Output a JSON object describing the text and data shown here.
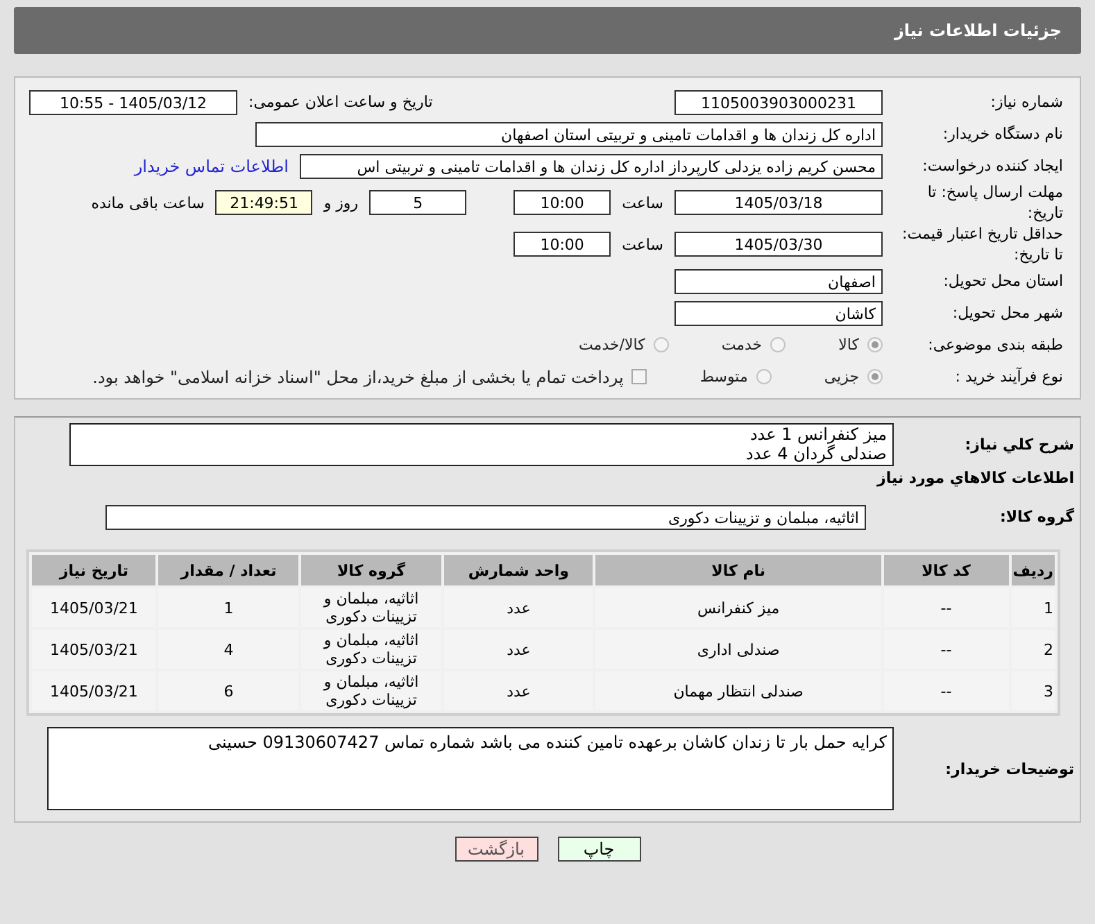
{
  "title": "جزئیات اطلاعات نیاز",
  "need_number": {
    "label": "شماره نیاز:",
    "value": "1105003903000231"
  },
  "announce": {
    "label": "تاریخ و ساعت اعلان عمومی:",
    "value": "1405/03/12 - 10:55"
  },
  "buyer_org": {
    "label": "نام دستگاه خریدار:",
    "value": "اداره کل زندان ها و اقدامات تامینی و تربیتی استان اصفهان"
  },
  "requester": {
    "label": "ایجاد کننده درخواست:",
    "value": "محسن کریم زاده یزدلی کارپرداز اداره کل زندان ها و اقدامات تامینی و تربیتی اس",
    "link": "اطلاعات تماس خریدار"
  },
  "reply_deadline": {
    "label": "مهلت ارسال پاسخ: تا تاریخ:",
    "date": "1405/03/18",
    "time_label": "ساعت",
    "time": "10:00",
    "days": "5",
    "days_label": "روز و",
    "remaining": "21:49:51",
    "remaining_label": "ساعت باقی مانده"
  },
  "validity": {
    "label": "حداقل تاریخ اعتبار قیمت: تا تاریخ:",
    "date": "1405/03/30",
    "time_label": "ساعت",
    "time": "10:00"
  },
  "province": {
    "label": "استان محل تحویل:",
    "value": "اصفهان"
  },
  "city": {
    "label": "شهر محل تحویل:",
    "value": "کاشان"
  },
  "category": {
    "label": "طبقه بندی موضوعی:",
    "options": [
      {
        "label": "کالا",
        "selected": true
      },
      {
        "label": "خدمت",
        "selected": false
      },
      {
        "label": "کالا/خدمت",
        "selected": false
      }
    ]
  },
  "purchase_type": {
    "label": "نوع فرآیند خرید :",
    "options": [
      {
        "label": "جزیی",
        "selected": true
      },
      {
        "label": "متوسط",
        "selected": false
      }
    ],
    "checkbox": {
      "label": "پرداخت تمام یا بخشی از مبلغ خرید،از محل \"اسناد خزانه اسلامی\" خواهد بود.",
      "checked": false
    }
  },
  "description": {
    "label": "شرح کلي نياز:",
    "lines": [
      "میز کنفرانس 1 عدد",
      "صندلی گردان 4 عدد"
    ]
  },
  "goods_title": "اطلاعات کالاهاي مورد نياز",
  "goods_group": {
    "label": "گروه کالا:",
    "value": "اثاثیه، مبلمان و تزیینات دکوری"
  },
  "table": {
    "columns": [
      "ردیف",
      "کد کالا",
      "نام کالا",
      "واحد شمارش",
      "گروه کالا",
      "تعداد / مقدار",
      "تاریخ نیاز"
    ],
    "rows": [
      [
        "1",
        "--",
        "میز کنفرانس",
        "عدد",
        "اثاثیه، مبلمان و تزیینات دکوری",
        "1",
        "1405/03/21"
      ],
      [
        "2",
        "--",
        "صندلی اداری",
        "عدد",
        "اثاثیه، مبلمان و تزیینات دکوری",
        "4",
        "1405/03/21"
      ],
      [
        "3",
        "--",
        "صندلی انتظار مهمان",
        "عدد",
        "اثاثیه، مبلمان و تزیینات دکوری",
        "6",
        "1405/03/21"
      ]
    ]
  },
  "buyer_notes": {
    "label": "توضیحات خریدار:",
    "value": "کرایه حمل بار تا زندان کاشان برعهده تامین کننده می باشد شماره تماس 09130607427 حسینی"
  },
  "buttons": [
    {
      "label": "چاپ",
      "kind": "print"
    },
    {
      "label": "بازگشت",
      "kind": "back"
    }
  ]
}
